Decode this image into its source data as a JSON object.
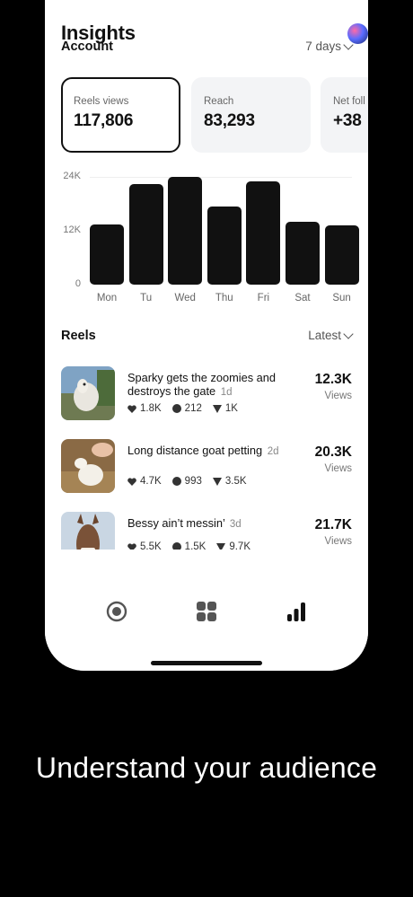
{
  "header": {
    "title": "Insights"
  },
  "account": {
    "label": "Account",
    "range": "7 days",
    "cards": [
      {
        "label": "Reels views",
        "value": "117,806"
      },
      {
        "label": "Reach",
        "value": "83,293"
      },
      {
        "label": "Net foll",
        "value": "+38"
      }
    ]
  },
  "chart_data": {
    "type": "bar",
    "categories": [
      "Mon",
      "Tu",
      "Wed",
      "Thu",
      "Fri",
      "Sat",
      "Sun"
    ],
    "values": [
      13500,
      22500,
      24000,
      17500,
      23000,
      14000,
      13300
    ],
    "ylim": [
      0,
      24000
    ],
    "yticks": [
      "24K",
      "12K",
      "0"
    ],
    "grid": true
  },
  "reels": {
    "label": "Reels",
    "sort": "Latest",
    "items": [
      {
        "title": "Sparky gets the zoomies and destroys the gate",
        "age": "1d",
        "likes": "1.8K",
        "comments": "212",
        "shares": "1K",
        "views": "12.3K",
        "views_unit": "Views"
      },
      {
        "title": "Long distance goat petting",
        "age": "2d",
        "likes": "4.7K",
        "comments": "993",
        "shares": "3.5K",
        "views": "20.3K",
        "views_unit": "Views"
      },
      {
        "title": "Bessy ain’t messin’",
        "age": "3d",
        "likes": "5.5K",
        "comments": "1.5K",
        "shares": "9.7K",
        "views": "21.7K",
        "views_unit": "Views"
      }
    ]
  },
  "tabbar": {
    "icons": [
      "record-icon",
      "grid-icon",
      "bar-chart-icon"
    ]
  },
  "tagline": "Understand your audience",
  "colors": {
    "accent": "#111111",
    "background": "#000000",
    "card": "#f3f4f6"
  }
}
